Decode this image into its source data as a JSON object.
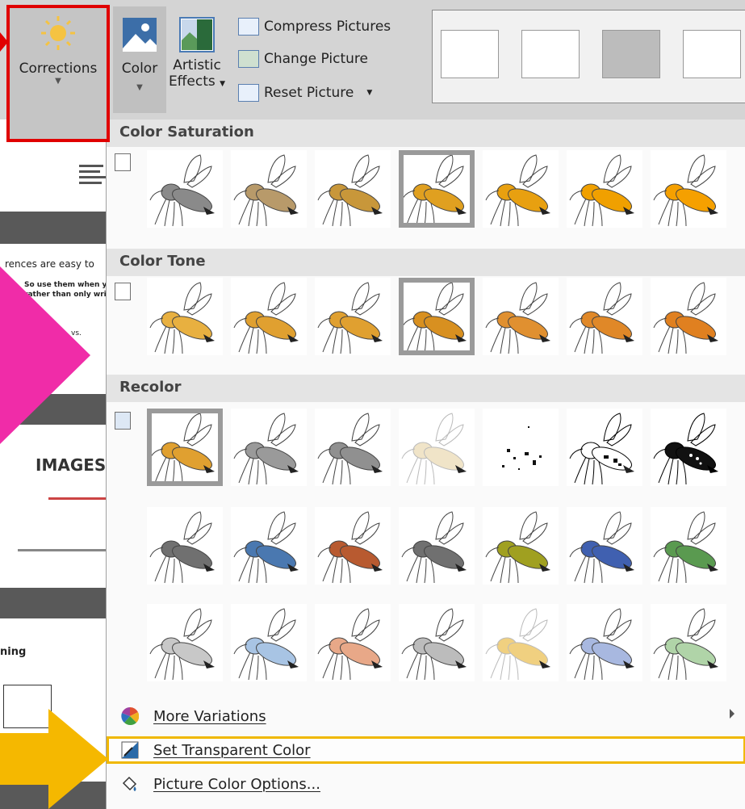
{
  "ribbon": {
    "corrections_label": "Corrections",
    "color_label": "Color",
    "artistic_label_1": "Artistic",
    "artistic_label_2": "Effects",
    "compress_label": "Compress Pictures",
    "change_label": "Change Picture",
    "reset_label": "Reset Picture",
    "style_thumbnails_count": 4
  },
  "document_preview": {
    "snippet_1": "rences are easy to",
    "snippet_2": "So use them when you",
    "snippet_3": "rather than only writin",
    "snippet_4": "vs.",
    "snippet_5": "IMAGES",
    "snippet_6": "ning"
  },
  "dropdown": {
    "sections": [
      {
        "title": "Color Saturation"
      },
      {
        "title": "Color Tone"
      },
      {
        "title": "Recolor"
      }
    ],
    "more_variations": "More Variations",
    "set_transparent": "Set Transparent Color",
    "picture_color_options": "Picture Color Options..."
  },
  "colors": {
    "highlight_red": "#e00000",
    "highlight_yellow": "#f0b800",
    "pink_arrow": "#f02ca8",
    "yellow_arrow": "#f5b800"
  },
  "swatches": {
    "saturation": [
      "#8a8a8a",
      "#b89a6a",
      "#c8973a",
      "#e0a020",
      "#e8a010",
      "#f0a000",
      "#f5a000"
    ],
    "tone": [
      "#e8b040",
      "#e0a030",
      "#e0a030",
      "#d89020",
      "#e09030",
      "#e08828",
      "#e08020"
    ],
    "recolor_row1": [
      "#e0a030",
      "#9a9a9a",
      "#909090",
      "#f0e4c8",
      "bw-sparse",
      "bw",
      "bw-dark"
    ],
    "recolor_row2": [
      "#707070",
      "#4a78b0",
      "#b85a30",
      "#707070",
      "#a0a020",
      "#4060b0",
      "#5a9a50"
    ],
    "recolor_row3": [
      "#c8c8c8",
      "#a8c4e4",
      "#e8a888",
      "#bcbcbc",
      "#f0d080",
      "#a8b8e0",
      "#b0d4a8"
    ]
  }
}
